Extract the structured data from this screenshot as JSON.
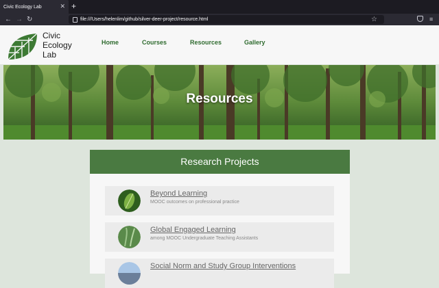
{
  "browser": {
    "tab_title": "Civic Ecology Lab",
    "tab_close_icon": "close-icon",
    "new_tab_icon": "plus-icon",
    "url": "file:///Users/helenlim/github/silver-deer-project/resource.html"
  },
  "site": {
    "brand": [
      "Civic",
      "Ecology",
      "Lab"
    ],
    "nav": [
      "Home",
      "Courses",
      "Resources",
      "Gallery"
    ],
    "brand_color": "#2f6b2f"
  },
  "hero": {
    "title": "Resources"
  },
  "section": {
    "title": "Research Projects",
    "header_color": "#4a7a41"
  },
  "projects": [
    {
      "title": "Beyond Learning",
      "subtitle": "MOOC outcomes on professional practice"
    },
    {
      "title": "Global Engaged Learning",
      "subtitle": "among MOOC Undergraduate Teaching Assistants"
    },
    {
      "title": "Social Norm and Study Group Interventions",
      "subtitle": ""
    }
  ]
}
